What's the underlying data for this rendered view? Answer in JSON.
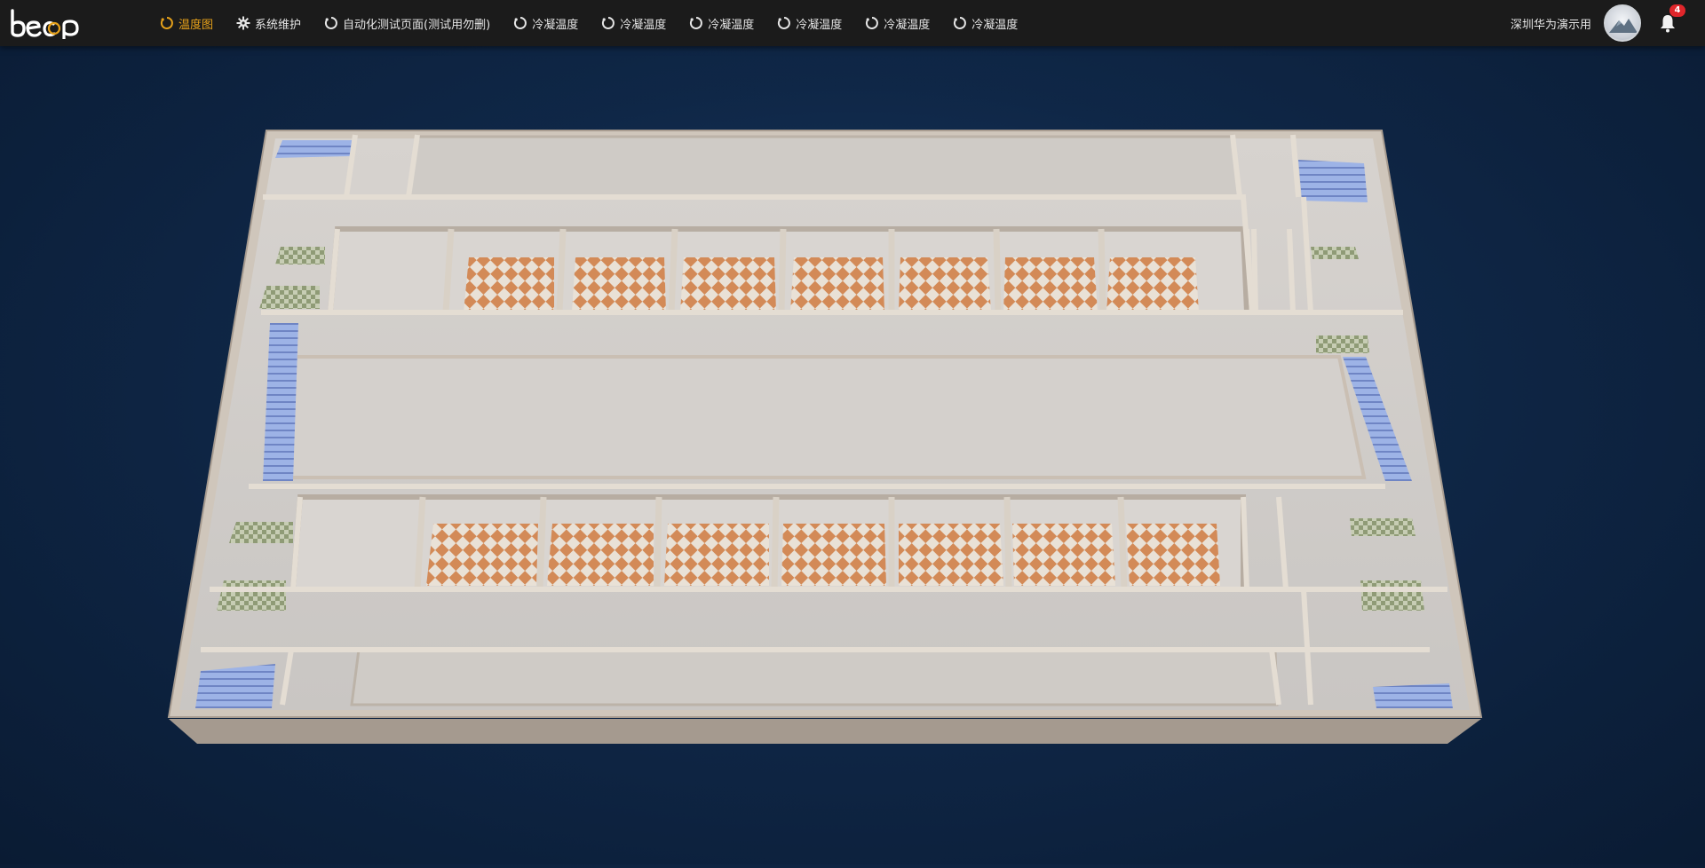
{
  "app": {
    "logo_text": "becp"
  },
  "nav": {
    "items": [
      {
        "label": "温度图",
        "icon": "temperature-ring-icon",
        "active": true
      },
      {
        "label": "系统维护",
        "icon": "gear-icon",
        "active": false
      },
      {
        "label": "自动化测试页面(测试用勿删)",
        "icon": "ring-icon",
        "active": false
      },
      {
        "label": "冷凝温度",
        "icon": "ring-icon",
        "active": false
      },
      {
        "label": "冷凝温度",
        "icon": "ring-icon",
        "active": false
      },
      {
        "label": "冷凝温度",
        "icon": "ring-icon",
        "active": false
      },
      {
        "label": "冷凝温度",
        "icon": "ring-icon",
        "active": false
      },
      {
        "label": "冷凝温度",
        "icon": "ring-icon",
        "active": false
      },
      {
        "label": "冷凝温度",
        "icon": "ring-icon",
        "active": false
      }
    ],
    "active_color": "#e7a21a"
  },
  "user": {
    "name": "深圳华为演示用",
    "avatar_icon": "user-avatar-icon"
  },
  "notifications": {
    "icon": "bell-icon",
    "count": "4",
    "badge_color": "#e0262b"
  },
  "scene": {
    "description_icon": "3d-floorplan-model"
  }
}
